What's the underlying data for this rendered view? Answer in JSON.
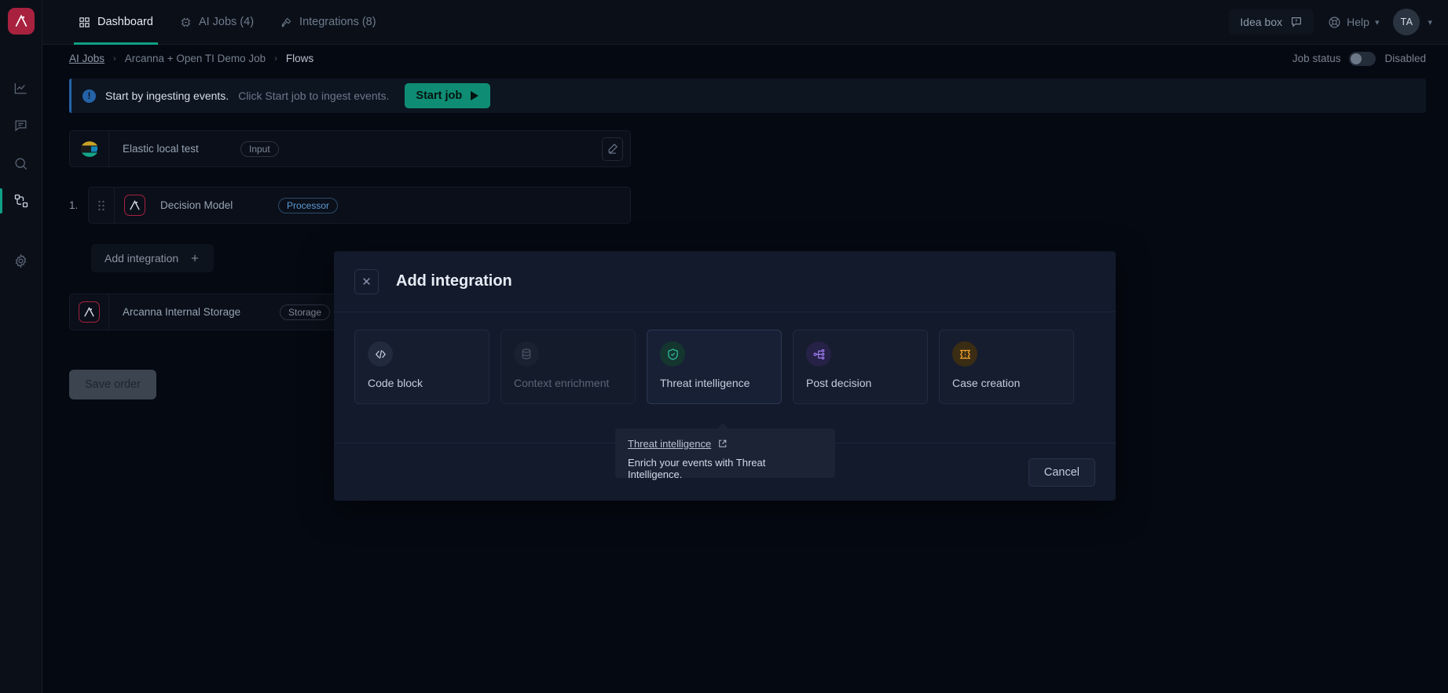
{
  "brand": {
    "logo_icon": "arcanna-logo-icon",
    "accent": "#0f9f86",
    "brand_red": "#a8213f"
  },
  "sidebar": {
    "items": [
      {
        "icon": "analytics-chart-icon",
        "name": "analytics",
        "active": false
      },
      {
        "icon": "feedback-comment-icon",
        "name": "feedback",
        "active": false
      },
      {
        "icon": "search-icon",
        "name": "search",
        "active": false
      },
      {
        "icon": "flows-nodes-icon",
        "name": "flows",
        "active": true
      },
      {
        "icon": "gear-icon",
        "name": "settings",
        "active": false
      }
    ]
  },
  "header": {
    "tabs": [
      {
        "label": "Dashboard",
        "icon": "grid-dashboard-icon",
        "active": true
      },
      {
        "label": "AI Jobs (4)",
        "icon": "chip-ai-icon",
        "active": false
      },
      {
        "label": "Integrations (8)",
        "icon": "plug-integration-icon",
        "active": false
      }
    ],
    "idea_box_label": "Idea box",
    "idea_box_icon": "speech-bubble-icon",
    "help_label": "Help",
    "help_icon": "lifebuoy-help-icon",
    "avatar_initials": "TA"
  },
  "breadcrumb": {
    "items": [
      {
        "label": "AI Jobs",
        "link": true
      },
      {
        "label": "Arcanna + Open TI Demo Job",
        "link": false
      },
      {
        "label": "Flows",
        "current": true
      }
    ],
    "separator": "›"
  },
  "job_status": {
    "label": "Job status",
    "value": "Disabled",
    "enabled": false
  },
  "alert": {
    "icon": "info-exclamation-icon",
    "strong": "Start by ingesting events.",
    "text": "Click Start job to ingest events.",
    "button_label": "Start job",
    "button_icon": "play-icon",
    "button_color": "#0f8d74"
  },
  "flow": {
    "rows": [
      {
        "name": "Elastic local test",
        "badge": "Input",
        "badge_type": "input",
        "icon": "elastic-logo-icon",
        "number": "",
        "has_edit": true,
        "has_grip": false
      },
      {
        "name": "Decision Model",
        "badge": "Processor",
        "badge_type": "processor",
        "icon": "arcanna-logo-icon",
        "number": "1.",
        "has_edit": false,
        "has_grip": true
      }
    ],
    "add_integration_label": "Add integration",
    "add_integration_icon": "plus-icon",
    "storage_row": {
      "name": "Arcanna Internal Storage",
      "badge": "Storage",
      "icon": "arcanna-logo-icon"
    },
    "save_order_label": "Save order"
  },
  "modal": {
    "title": "Add integration",
    "close_icon": "close-x-icon",
    "options": [
      {
        "label": "Code block",
        "icon": "code-brackets-icon",
        "state": "normal",
        "icon_color": "#cfd8e6",
        "bg": "#222b3d"
      },
      {
        "label": "Context enrichment",
        "icon": "database-icon",
        "state": "disabled",
        "icon_color": "#4d5768",
        "bg": "#1a2130"
      },
      {
        "label": "Threat intelligence",
        "icon": "shield-check-icon",
        "state": "selected",
        "icon_color": "#2fbfa3",
        "bg": "#14362f"
      },
      {
        "label": "Post decision",
        "icon": "branch-nodes-icon",
        "state": "normal",
        "icon_color": "#9d7cf0",
        "bg": "#262146"
      },
      {
        "label": "Case creation",
        "icon": "ticket-icon",
        "state": "normal",
        "icon_color": "#f0a02a",
        "bg": "#3a2d14"
      }
    ],
    "cancel_label": "Cancel"
  },
  "tooltip": {
    "title": "Threat intelligence",
    "external_icon": "external-link-icon",
    "description": "Enrich your events with Threat Intelligence."
  }
}
